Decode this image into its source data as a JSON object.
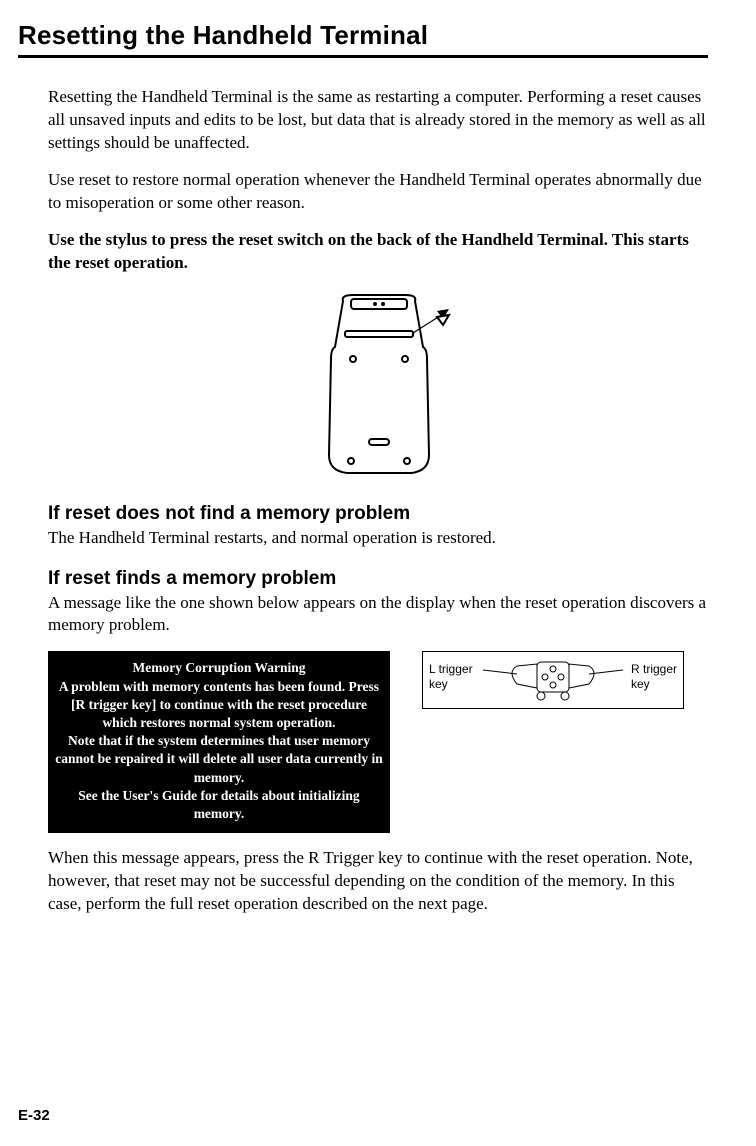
{
  "title": "Resetting the Handheld Terminal",
  "intro_p1": "Resetting the Handheld Terminal is the same as restarting a computer. Performing a reset causes all unsaved inputs and edits to be lost, but data that is already stored in the memory as well as all settings should be unaffected.",
  "intro_p2": "Use reset to restore normal operation whenever the Handheld Terminal operates abnormally due to misoperation or some other reason.",
  "instruction": "Use the stylus to press the reset switch on the back of the Handheld Terminal. This starts the reset operation.",
  "sub1_head": "If reset does not find a memory problem",
  "sub1_body": "The Handheld Terminal restarts, and normal operation is restored.",
  "sub2_head": "If reset finds a memory problem",
  "sub2_body": "A message like the one shown below appears on the display when the reset operation discovers a memory problem.",
  "warning_title": "Memory Corruption Warning",
  "warning_l1": "A problem with memory contents has been found. Press [R trigger key] to continue with the reset procedure which restores normal system operation.",
  "warning_l2": "Note that if the system determines that user memory cannot be repaired it will delete all user data currently in memory.",
  "warning_l3": "See the User's Guide for details about initializing memory.",
  "l_trigger": "L trigger key",
  "r_trigger": "R trigger key",
  "closing": "When this message appears, press the R Trigger key to continue with the reset operation. Note, however, that reset may not be successful depending on the condition of the memory. In this case, perform the full reset operation described on the next page.",
  "pagenum": "E-32"
}
